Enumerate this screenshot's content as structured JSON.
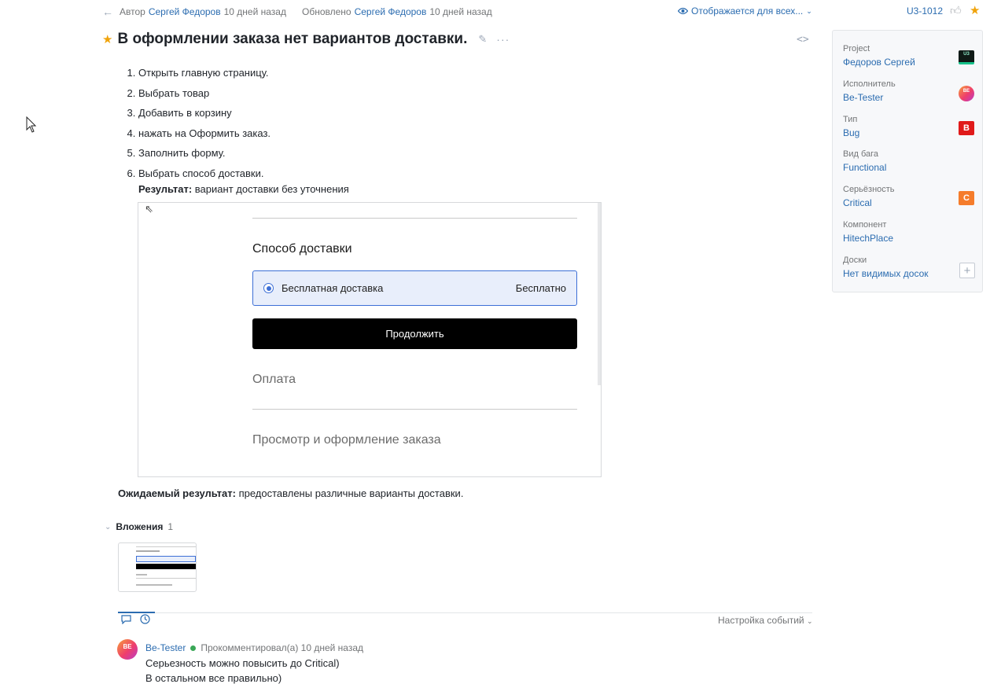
{
  "meta": {
    "back_icon": "arrow-left-icon",
    "author_prefix": "Автор",
    "author_name": "Сергей Федоров",
    "author_time": "10 дней назад",
    "updated_prefix": "Обновлено",
    "updated_name": "Сергей Федоров",
    "updated_time": "10 дней назад",
    "visibility": "Отображается для всех...",
    "issue_id": "U3-1012"
  },
  "issue": {
    "title": "В оформлении заказа нет вариантов доставки.",
    "steps": [
      "Открыть главную страницу.",
      "Выбрать товар",
      "Добавить в корзину",
      "нажать на Оформить заказ.",
      "Заполнить форму.",
      "Выбрать способ доставки."
    ],
    "result_label": "Результат:",
    "result_text": " вариант доставки без уточнения",
    "expected_label": "Ожидаемый результат:",
    "expected_text": " предоставлены различные варианты доставки."
  },
  "screenshot": {
    "delivery_heading": "Способ доставки",
    "option_label": "Бесплатная доставка",
    "option_price": "Бесплатно",
    "continue_button": "Продолжить",
    "payment_heading": "Оплата",
    "review_heading": "Просмотр и оформление заказа"
  },
  "attachments": {
    "label": "Вложения",
    "count": "1"
  },
  "activity": {
    "events_setting": "Настройка событий"
  },
  "comment": {
    "avatar_initials": "BE",
    "author": "Be-Tester",
    "meta": "Прокомментировал(а) 10 дней назад",
    "line1": "Серьезность можно повысить до Critical)",
    "line2": "В остальном все правильно)"
  },
  "panel": {
    "fields": [
      {
        "label": "Project",
        "value": "Федоров Сергей",
        "badge": "U3"
      },
      {
        "label": "Исполнитель",
        "value": "Be-Tester",
        "badge": "BE"
      },
      {
        "label": "Тип",
        "value": "Bug",
        "badge": "B"
      },
      {
        "label": "Вид бага",
        "value": "Functional"
      },
      {
        "label": "Серьёзность",
        "value": "Critical",
        "badge": "C"
      },
      {
        "label": "Компонент",
        "value": "HitechPlace"
      },
      {
        "label": "Доски",
        "value": "Нет видимых досок",
        "badge": "+"
      }
    ]
  },
  "colors": {
    "link": "#2b6cb0",
    "star": "#f0a30a",
    "bug_badge": "#e01a1a",
    "critical_badge": "#f57c2b",
    "online": "#3aa757"
  }
}
